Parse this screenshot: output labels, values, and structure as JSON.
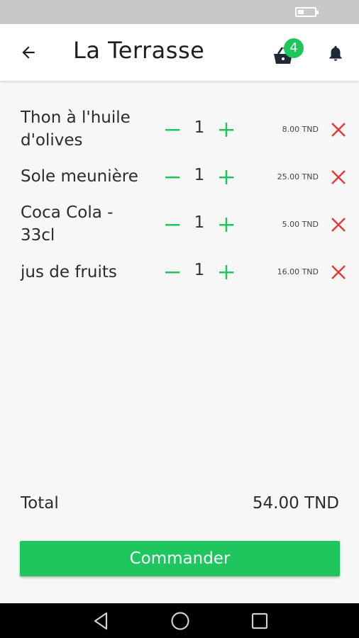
{
  "header": {
    "title": "La Terrasse",
    "cart_count": "4"
  },
  "items": [
    {
      "name": "Thon à l'huile d'olives",
      "qty": "1",
      "price": "8.00 TND"
    },
    {
      "name": "Sole meunière",
      "qty": "1",
      "price": "25.00 TND"
    },
    {
      "name": "Coca Cola - 33cl",
      "qty": "1",
      "price": "5.00 TND"
    },
    {
      "name": "jus de fruits",
      "qty": "1",
      "price": "16.00 TND"
    }
  ],
  "summary": {
    "total_label": "Total",
    "total_value": "54.00 TND"
  },
  "order_button": {
    "label": "Commander"
  },
  "colors": {
    "accent_green": "#1fc55d",
    "remove_red": "#e53935",
    "app_bar_bg": "#ffffff",
    "page_bg": "#f7f7f7"
  },
  "icons": {
    "back": "arrow-left-icon",
    "cart": "basket-icon",
    "bell": "bell-icon",
    "minus": "minus-icon",
    "plus": "plus-icon",
    "remove": "close-icon",
    "nav_back": "triangle-back-icon",
    "nav_home": "circle-home-icon",
    "nav_recent": "square-recent-icon"
  }
}
